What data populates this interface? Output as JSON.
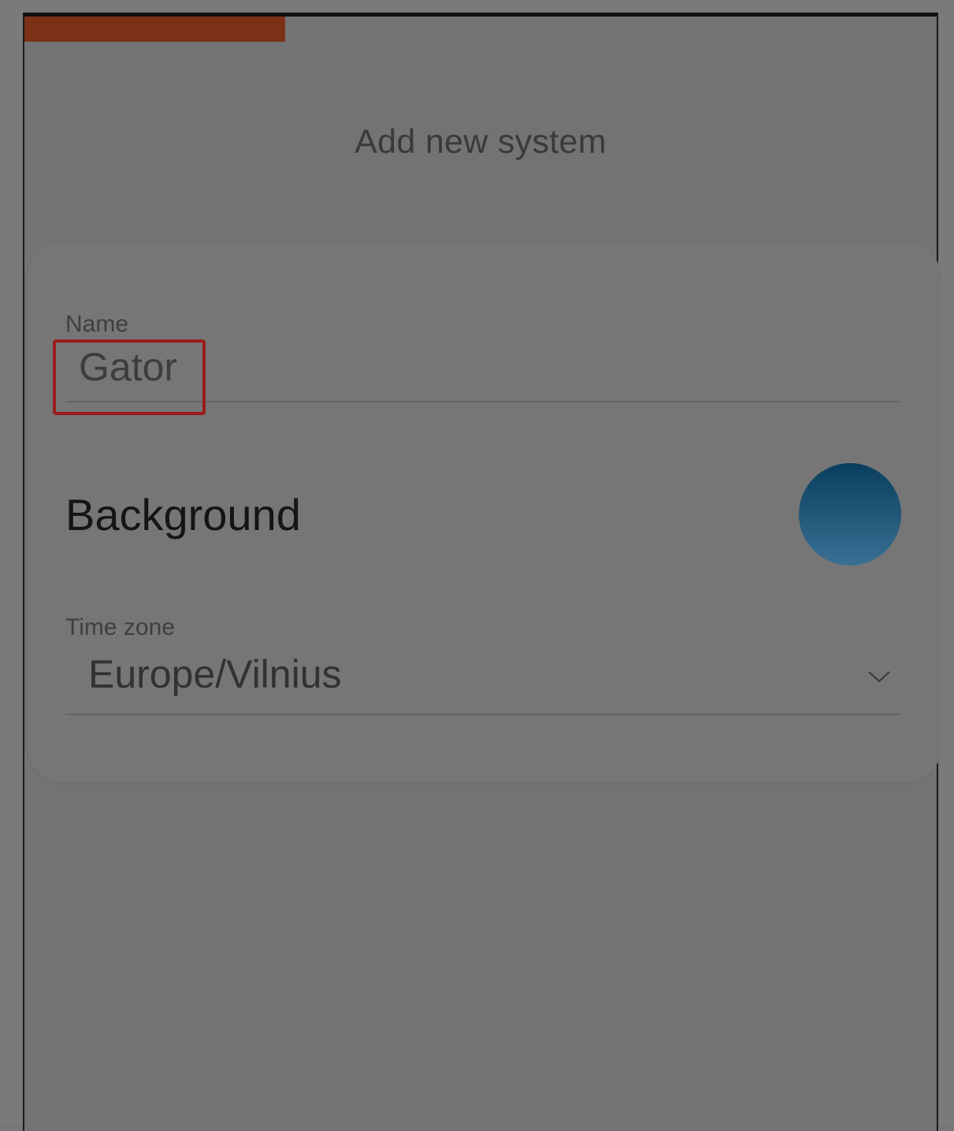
{
  "header": {
    "title": "Add new system"
  },
  "form": {
    "name": {
      "label": "Name",
      "value": "Gator"
    },
    "background": {
      "label": "Background",
      "swatch_colors": [
        "#0a3e5e",
        "#3a7094"
      ]
    },
    "time_zone": {
      "label": "Time zone",
      "value": "Europe/Vilnius"
    }
  },
  "colors": {
    "accent": "#7c3116",
    "highlight": "#9b1c1c"
  },
  "icons": {
    "dropdown": "chevron-down-icon"
  }
}
